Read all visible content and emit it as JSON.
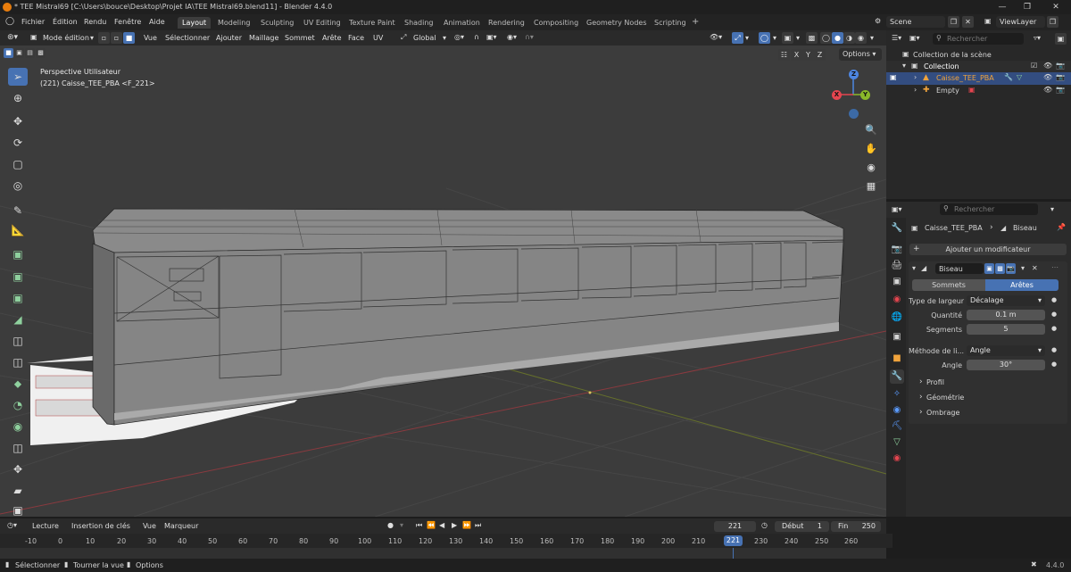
{
  "titlebar": {
    "title": "* TEE Mistral69 [C:\\Users\\bouce\\Desktop\\Projet IA\\TEE Mistral69.blend11] - Blender 4.4.0"
  },
  "menu": {
    "items": [
      "Fichier",
      "Édition",
      "Rendu",
      "Fenêtre",
      "Aide"
    ]
  },
  "workspaces": {
    "tabs": [
      "Layout",
      "Modeling",
      "Sculpting",
      "UV Editing",
      "Texture Paint",
      "Shading",
      "Animation",
      "Rendering",
      "Compositing",
      "Geometry Nodes",
      "Scripting"
    ],
    "active": "Layout",
    "add": "+"
  },
  "scene": {
    "name": "Scene",
    "view_layer": "ViewLayer"
  },
  "viewport_header": {
    "mode": "Mode édition",
    "menus": [
      "Vue",
      "Sélectionner",
      "Ajouter",
      "Maillage",
      "Sommet",
      "Arête",
      "Face",
      "UV"
    ],
    "orientation": "Global",
    "axes": [
      "X",
      "Y",
      "Z"
    ],
    "options": "Options"
  },
  "viewport": {
    "view_name": "Perspective Utilisateur",
    "object_info": "(221) Caisse_TEE_PBA <F_221>",
    "gizmo": {
      "x": "X",
      "y": "Y",
      "z": "Z"
    }
  },
  "outliner": {
    "search_placeholder": "Rechercher",
    "root": "Collection de la scène",
    "collection": "Collection",
    "items": [
      {
        "name": "Caisse_TEE_PBA",
        "selected": true
      },
      {
        "name": "Empty",
        "selected": false
      }
    ]
  },
  "properties": {
    "search_placeholder": "Rechercher",
    "breadcrumb_object": "Caisse_TEE_PBA",
    "breadcrumb_modifier": "Biseau",
    "add_modifier": "Ajouter un modificateur",
    "modifier_name": "Biseau",
    "affect_tabs": [
      "Sommets",
      "Arêtes"
    ],
    "affect_active": "Arêtes",
    "fields": {
      "width_type_label": "Type de largeur",
      "width_type_value": "Décalage",
      "amount_label": "Quantité",
      "amount_value": "0.1 m",
      "segments_label": "Segments",
      "segments_value": "5",
      "limit_method_label": "Méthode de li...",
      "limit_method_value": "Angle",
      "angle_label": "Angle",
      "angle_value": "30°"
    },
    "panels": [
      "Profil",
      "Géométrie",
      "Ombrage"
    ]
  },
  "timeline": {
    "menus": [
      "Lecture",
      "Insertion de clés",
      "Vue",
      "Marqueur"
    ],
    "current_frame": "221",
    "start_label": "Début",
    "start_value": "1",
    "end_label": "Fin",
    "end_value": "250",
    "ticks": [
      "-10",
      "0",
      "10",
      "20",
      "30",
      "40",
      "50",
      "60",
      "70",
      "80",
      "90",
      "100",
      "110",
      "120",
      "130",
      "140",
      "150",
      "160",
      "170",
      "180",
      "190",
      "200",
      "210",
      "221",
      "230",
      "240",
      "250",
      "260"
    ]
  },
  "statusbar": {
    "items": [
      "Sélectionner",
      "Tourner la vue",
      "Options"
    ],
    "version": "4.4.0"
  },
  "colors": {
    "accent": "#4772b3",
    "selected_text": "#f0a33c",
    "viewport_bg": "#3c3c3c",
    "x_axis": "#e5454f",
    "y_axis": "#8ab82a",
    "z_axis": "#4d86e1"
  }
}
